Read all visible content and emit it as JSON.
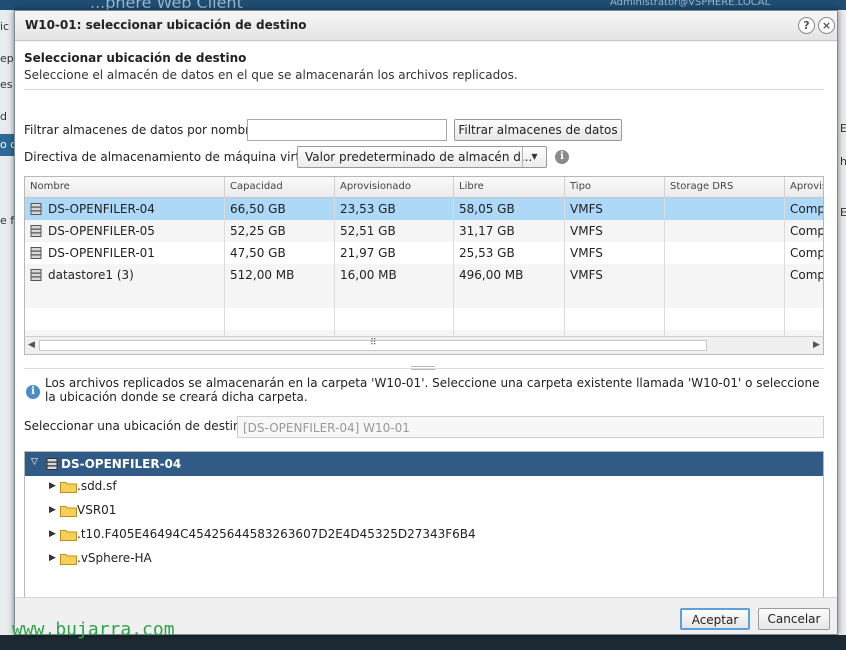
{
  "background": {
    "app_title": "...phere Web Client",
    "user_text": "Administrator@VSPHERE.LOCAL",
    "left_fragments": [
      "ic",
      "epl",
      "es",
      "d",
      "o de",
      "e fi"
    ],
    "right_fragments": [
      "E",
      "h",
      "E"
    ]
  },
  "dialog": {
    "title": "W10-01: seleccionar ubicación de destino",
    "help_icon": "?",
    "close_icon": "×"
  },
  "header": {
    "title": "Seleccionar ubicación de destino",
    "subtitle": "Seleccione el almacén de datos en el que se almacenarán los archivos replicados."
  },
  "filter": {
    "label": "Filtrar almacenes de datos por nombre:",
    "value": "",
    "button_label": "Filtrar almacenes de datos"
  },
  "policy": {
    "label": "Directiva de almacenamiento de máquina virtual:",
    "selected": "Valor predeterminado de almacén d...",
    "info_icon": "i"
  },
  "table": {
    "columns": [
      "Nombre",
      "Capacidad",
      "Aprovisionado",
      "Libre",
      "Tipo",
      "Storage DRS",
      "Aprovis"
    ],
    "rows": [
      {
        "name": "DS-OPENFILER-04",
        "capacity": "66,50 GB",
        "provisioned": "23,53 GB",
        "free": "58,05 GB",
        "type": "VMFS",
        "sdrs": "",
        "prov": "Comp",
        "selected": true
      },
      {
        "name": "DS-OPENFILER-05",
        "capacity": "52,25 GB",
        "provisioned": "52,51 GB",
        "free": "31,17 GB",
        "type": "VMFS",
        "sdrs": "",
        "prov": "Comp",
        "selected": false
      },
      {
        "name": "DS-OPENFILER-01",
        "capacity": "47,50 GB",
        "provisioned": "21,97 GB",
        "free": "25,53 GB",
        "type": "VMFS",
        "sdrs": "",
        "prov": "Comp",
        "selected": false
      },
      {
        "name": "datastore1 (3)",
        "capacity": "512,00 MB",
        "provisioned": "16,00 MB",
        "free": "496,00 MB",
        "type": "VMFS",
        "sdrs": "",
        "prov": "Comp",
        "selected": false
      }
    ],
    "scroll_left": "◀",
    "scroll_right": "▶",
    "scroll_grip": "⠿"
  },
  "note": {
    "text": "Los archivos replicados se almacenarán en la carpeta 'W10-01'. Seleccione una carpeta existente llamada 'W10-01' o seleccione la ubicación donde se creará dicha carpeta."
  },
  "destination": {
    "label": "Seleccionar una ubicación de destino",
    "value": "[DS-OPENFILER-04] W10-01"
  },
  "tree": {
    "root": "DS-OPENFILER-04",
    "root_arrow": "▽",
    "items": [
      ".sdd.sf",
      "VSR01",
      ".t10.F405E46494C45425644583263607D2E4D45325D27343F6B4",
      ".vSphere-HA"
    ],
    "item_arrow": "▶"
  },
  "footer": {
    "accept_label": "Aceptar",
    "cancel_label": "Cancelar"
  },
  "watermark": "www.bujarra.com",
  "colors": {
    "selected_row": "#add8f7",
    "tree_selected": "#2f5b86",
    "primary_border": "#5aa0dc",
    "watermark": "#2fa34a"
  }
}
